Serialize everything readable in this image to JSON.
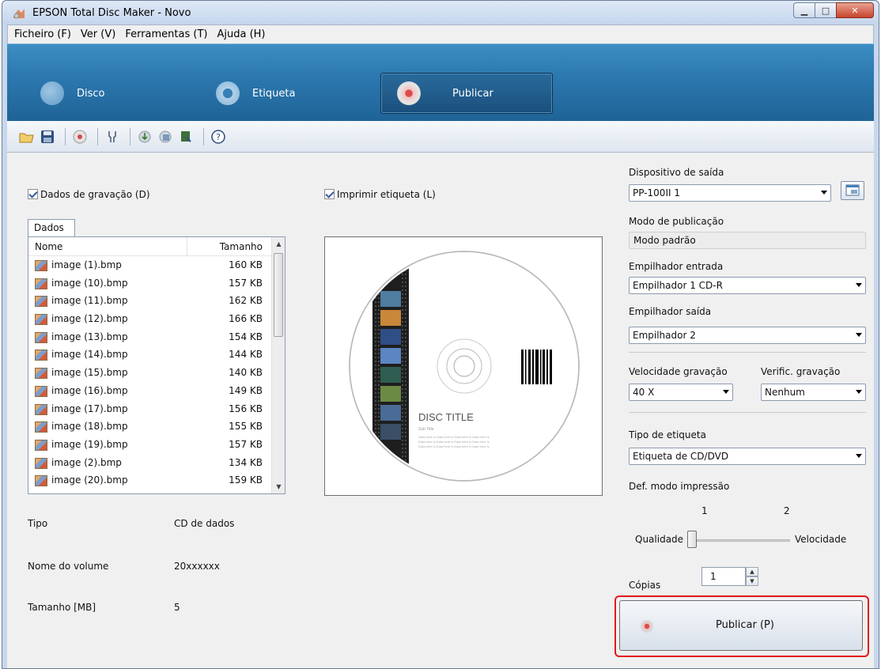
{
  "window": {
    "title": "EPSON Total Disc Maker - Novo"
  },
  "menu": [
    "Ficheiro (F)",
    "Ver (V)",
    "Ferramentas (T)",
    "Ajuda (H)"
  ],
  "tabs": {
    "disc": "Disco",
    "label": "Etiqueta",
    "publish": "Publicar"
  },
  "left": {
    "data_checkbox": "Dados de gravação (D)",
    "tab": "Dados",
    "columns": {
      "name": "Nome",
      "size": "Tamanho"
    },
    "files": [
      {
        "name": "image (1).bmp",
        "size": "160 KB"
      },
      {
        "name": "image (10).bmp",
        "size": "157 KB"
      },
      {
        "name": "image (11).bmp",
        "size": "162 KB"
      },
      {
        "name": "image (12).bmp",
        "size": "166 KB"
      },
      {
        "name": "image (13).bmp",
        "size": "154 KB"
      },
      {
        "name": "image (14).bmp",
        "size": "144 KB"
      },
      {
        "name": "image (15).bmp",
        "size": "140 KB"
      },
      {
        "name": "image (16).bmp",
        "size": "149 KB"
      },
      {
        "name": "image (17).bmp",
        "size": "156 KB"
      },
      {
        "name": "image (18).bmp",
        "size": "155 KB"
      },
      {
        "name": "image (19).bmp",
        "size": "157 KB"
      },
      {
        "name": "image (2).bmp",
        "size": "134 KB"
      },
      {
        "name": "image (20).bmp",
        "size": "159 KB"
      }
    ],
    "info": {
      "type_label": "Tipo",
      "type_value": "CD de dados",
      "volume_label": "Nome do volume",
      "volume_value": "20xxxxxx",
      "size_label": "Tamanho [MB]",
      "size_value": "5"
    }
  },
  "preview": {
    "print_checkbox": "Imprimir etiqueta (L)",
    "disc_title": "DISC TITLE",
    "disc_subtitle": "Sub Title",
    "disc_body": "Data here is Data here is Data here is Data here is"
  },
  "right": {
    "output_device_label": "Dispositivo de saída",
    "output_device_value": "PP-100II 1",
    "publish_mode_label": "Modo de publicação",
    "publish_mode_value": "Modo padrão",
    "input_stacker_label": "Empilhador entrada",
    "input_stacker_value": "Empilhador 1 CD-R",
    "output_stacker_label": "Empilhador saída",
    "output_stacker_value": "Empilhador 2",
    "write_speed_label": "Velocidade gravação",
    "write_speed_value": "40 X",
    "verify_label": "Verific. gravação",
    "verify_value": "Nenhum",
    "label_type_label": "Tipo de etiqueta",
    "label_type_value": "Etiqueta de CD/DVD",
    "print_mode_label": "Def. modo impressão",
    "slider_tick_1": "1",
    "slider_tick_2": "2",
    "slider_left": "Qualidade",
    "slider_right": "Velocidade",
    "slider_position": 1,
    "copies_label": "Cópias",
    "copies_value": "1",
    "publish_button": "Publicar (P)"
  }
}
